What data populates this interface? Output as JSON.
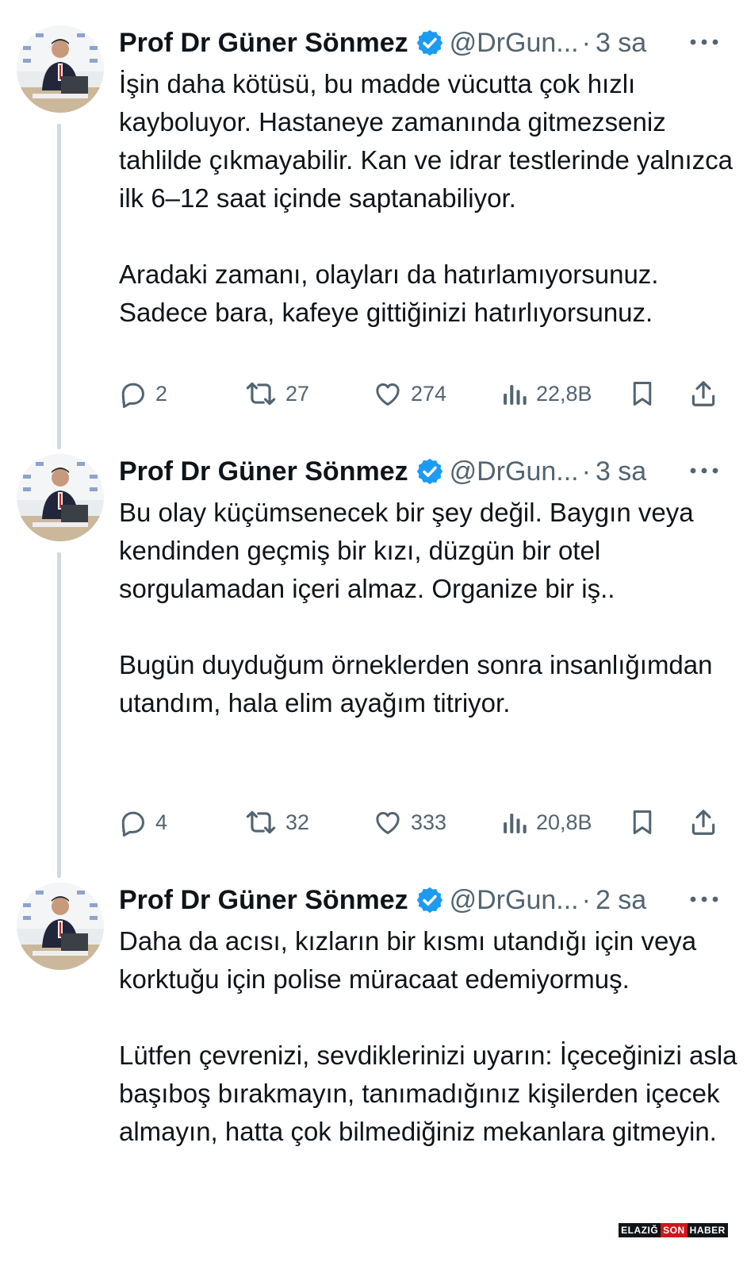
{
  "tweets": [
    {
      "author_name": "Prof Dr Güner Sönmez",
      "handle": "@DrGun...",
      "time": "3 sa",
      "paragraphs": [
        "İşin daha kötüsü, bu madde vücutta çok hızlı kayboluyor. Hastaneye zamanında gitmezseniz tahlilde çıkmayabilir. Kan ve idrar testlerinde yalnızca ilk 6–12 saat içinde saptanabiliyor.",
        "Aradaki zamanı, olayları da hatırlamıyorsunuz. Sadece bara, kafeye gittiğinizi hatırlıyorsunuz."
      ],
      "replies": "2",
      "retweets": "27",
      "likes": "274",
      "views": "22,8B"
    },
    {
      "author_name": "Prof Dr Güner Sönmez",
      "handle": "@DrGun...",
      "time": "3 sa",
      "paragraphs": [
        "Bu olay küçümsenecek bir şey değil. Baygın veya kendinden geçmiş bir kızı, düzgün bir otel sorgulamadan içeri almaz. Organize bir iş..",
        "Bugün duyduğum örneklerden sonra insanlığımdan utandım, hala elim ayağım titriyor."
      ],
      "replies": "4",
      "retweets": "32",
      "likes": "333",
      "views": "20,8B"
    },
    {
      "author_name": "Prof Dr Güner Sönmez",
      "handle": "@DrGun...",
      "time": "2 sa",
      "paragraphs": [
        "Daha da acısı, kızların bir kısmı utandığı için veya korktuğu için polise müracaat edemiyormuş.",
        "Lütfen çevrenizi, sevdiklerinizi uyarın: İçeceğinizi asla başıboş bırakmayın, tanımadığınız kişilerden içecek almayın, hatta çok bilmediğiniz mekanlara gitmeyin."
      ]
    }
  ],
  "watermark": {
    "part1": "ELAZIĞ",
    "part2": "SON",
    "part3": "HABER"
  },
  "icons": {
    "verified": "verified-badge-icon",
    "more": "more-options-icon",
    "reply": "reply-icon",
    "retweet": "retweet-icon",
    "like": "like-icon",
    "views": "views-icon",
    "bookmark": "bookmark-icon",
    "share": "share-icon"
  },
  "colors": {
    "text": "#0f1419",
    "secondary": "#536471",
    "verified": "#1d9bf0",
    "thread_line": "#cfd9de"
  }
}
